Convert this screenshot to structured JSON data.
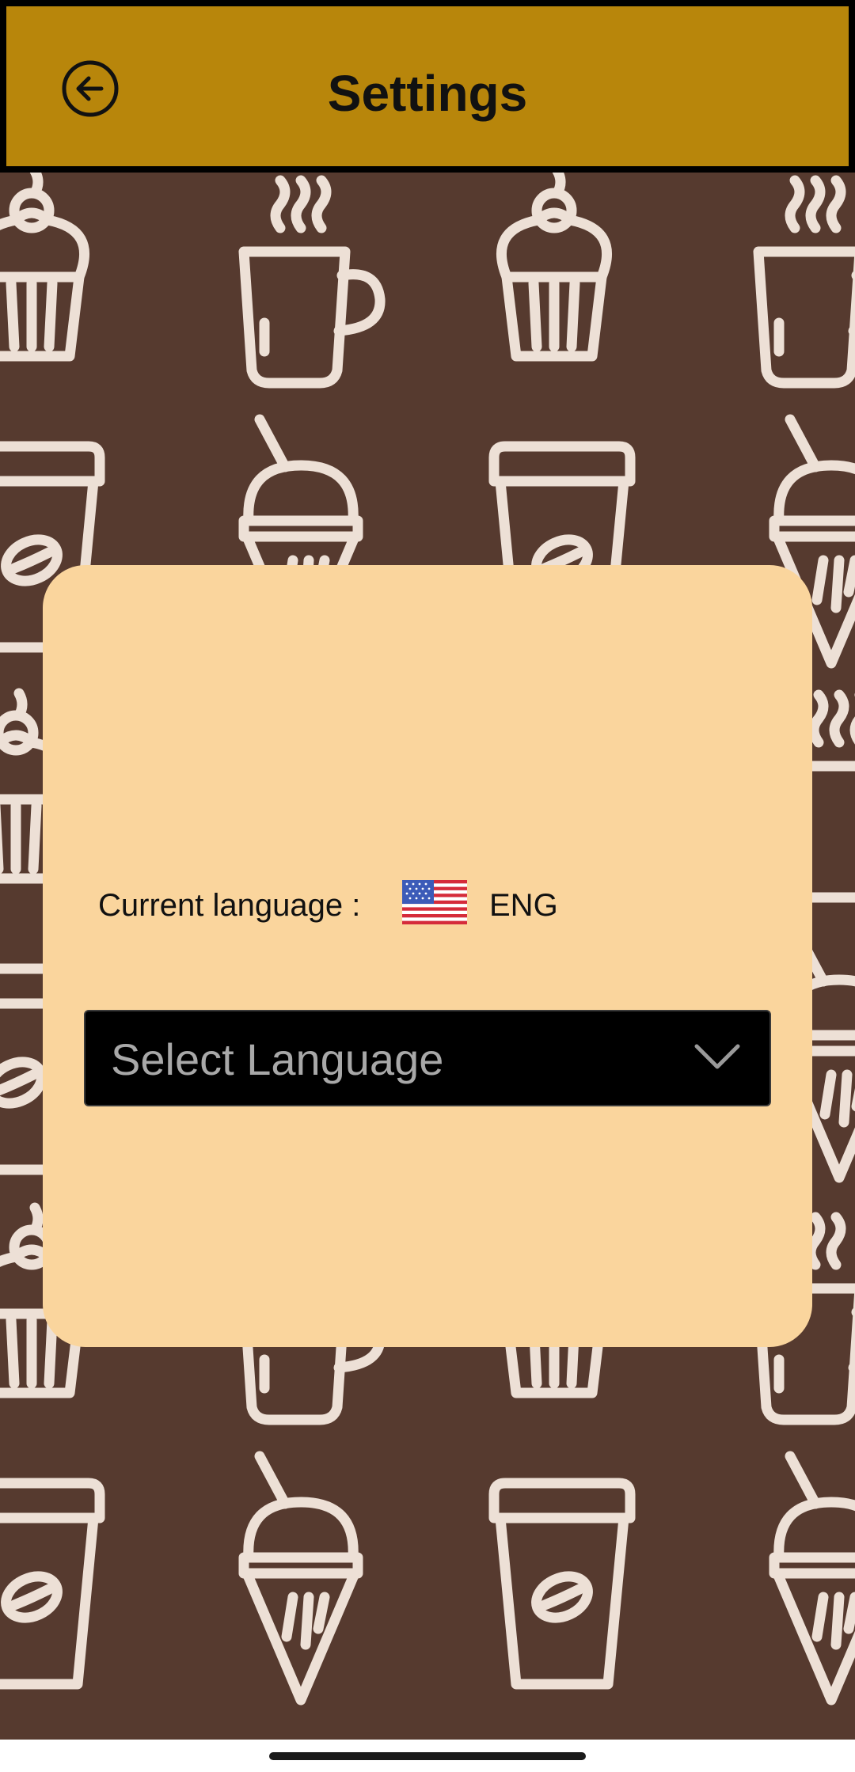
{
  "header": {
    "title": "Settings",
    "back_icon": "arrow-left-circle-icon"
  },
  "card": {
    "current_language_label": "Current language :",
    "current_language_code": "ENG",
    "flag_icon": "us-flag-icon",
    "select_placeholder": "Select Language",
    "select_icon": "chevron-down-icon"
  },
  "theme": {
    "header_bg": "#b8860b",
    "page_bg": "#563a2f",
    "card_bg": "#fad59d",
    "select_bg": "#000000",
    "pattern_color": "#ede0d6"
  }
}
